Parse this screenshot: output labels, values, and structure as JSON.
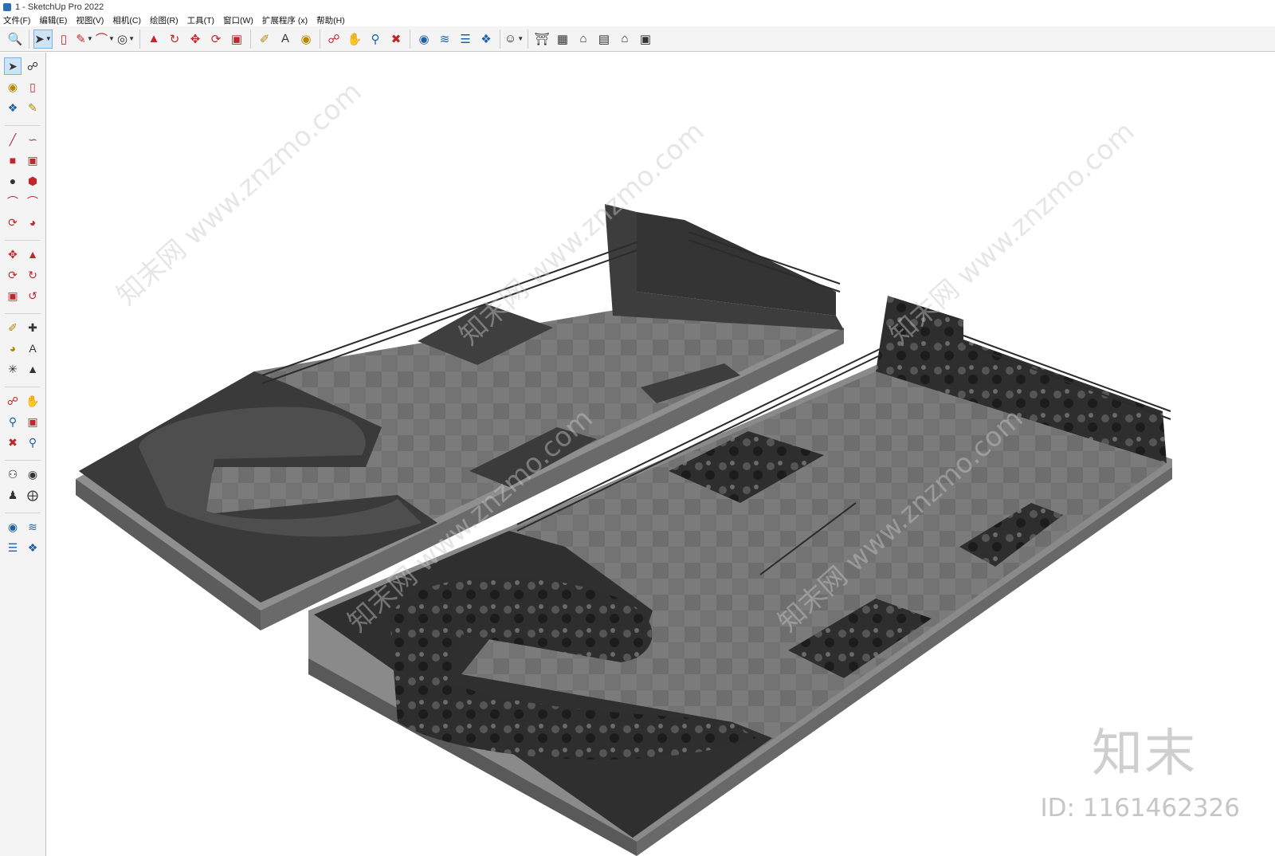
{
  "window": {
    "title": "1 - SketchUp Pro 2022"
  },
  "menu": [
    "文件(F)",
    "编辑(E)",
    "视图(V)",
    "相机(C)",
    "绘图(R)",
    "工具(T)",
    "窗口(W)",
    "扩展程序 (x)",
    "帮助(H)"
  ],
  "toolbar_icons": [
    "search-icon",
    "select-icon",
    "eraser-icon",
    "pencil-icon",
    "arc-icon",
    "circle-icon",
    "pushpull-icon",
    "followme-icon",
    "move-icon",
    "rotate-icon",
    "scale-icon",
    "tape-icon",
    "text-icon",
    "paint-icon",
    "orbit-icon",
    "pan-icon",
    "zoom-icon",
    "zoom-extents-icon",
    "section-icon",
    "sandbox-icon",
    "layers-icon",
    "component-icon",
    "account-icon",
    "warehouse-icon",
    "extension-icon",
    "home-icon",
    "outliner-icon",
    "house-icon",
    "box-icon"
  ],
  "watermark": {
    "url_text": "知末网 www.znzmo.com",
    "logo": "知末",
    "id": "ID: 1161462326"
  }
}
